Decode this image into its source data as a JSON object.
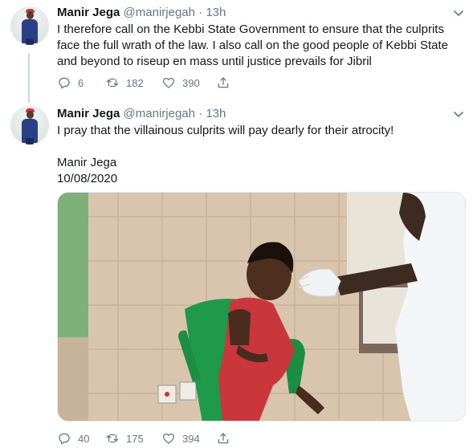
{
  "tweets": [
    {
      "name": "Manir Jega",
      "handle": "@manirjegah",
      "separator": "·",
      "time": "13h",
      "text_lines": [
        "I therefore call on the Kebbi State Government to ensure that the culprits",
        "face the full wrath of the law. I also call on the good people of Kebbi State",
        "and beyond to riseup en mass until justice prevails for Jibril"
      ],
      "replies": "6",
      "retweets": "182",
      "likes": "390"
    },
    {
      "name": "Manir Jega",
      "handle": "@manirjegah",
      "separator": "·",
      "time": "13h",
      "text_lines": [
        "I pray that the villainous culprits will pay dearly for their atrocity!",
        "",
        "Manir Jega",
        "10/08/2020"
      ],
      "replies": "40",
      "retweets": "175",
      "likes": "394"
    }
  ],
  "icons": {
    "reply": "comment-bubble-icon",
    "retweet": "retweet-icon",
    "like": "heart-icon",
    "share": "share-upload-icon",
    "menu": "chevron-down-icon"
  },
  "colors": {
    "text": "#14171a",
    "secondary": "#657786",
    "thread_line": "#ccd6dd",
    "border": "#e1e8ed"
  }
}
